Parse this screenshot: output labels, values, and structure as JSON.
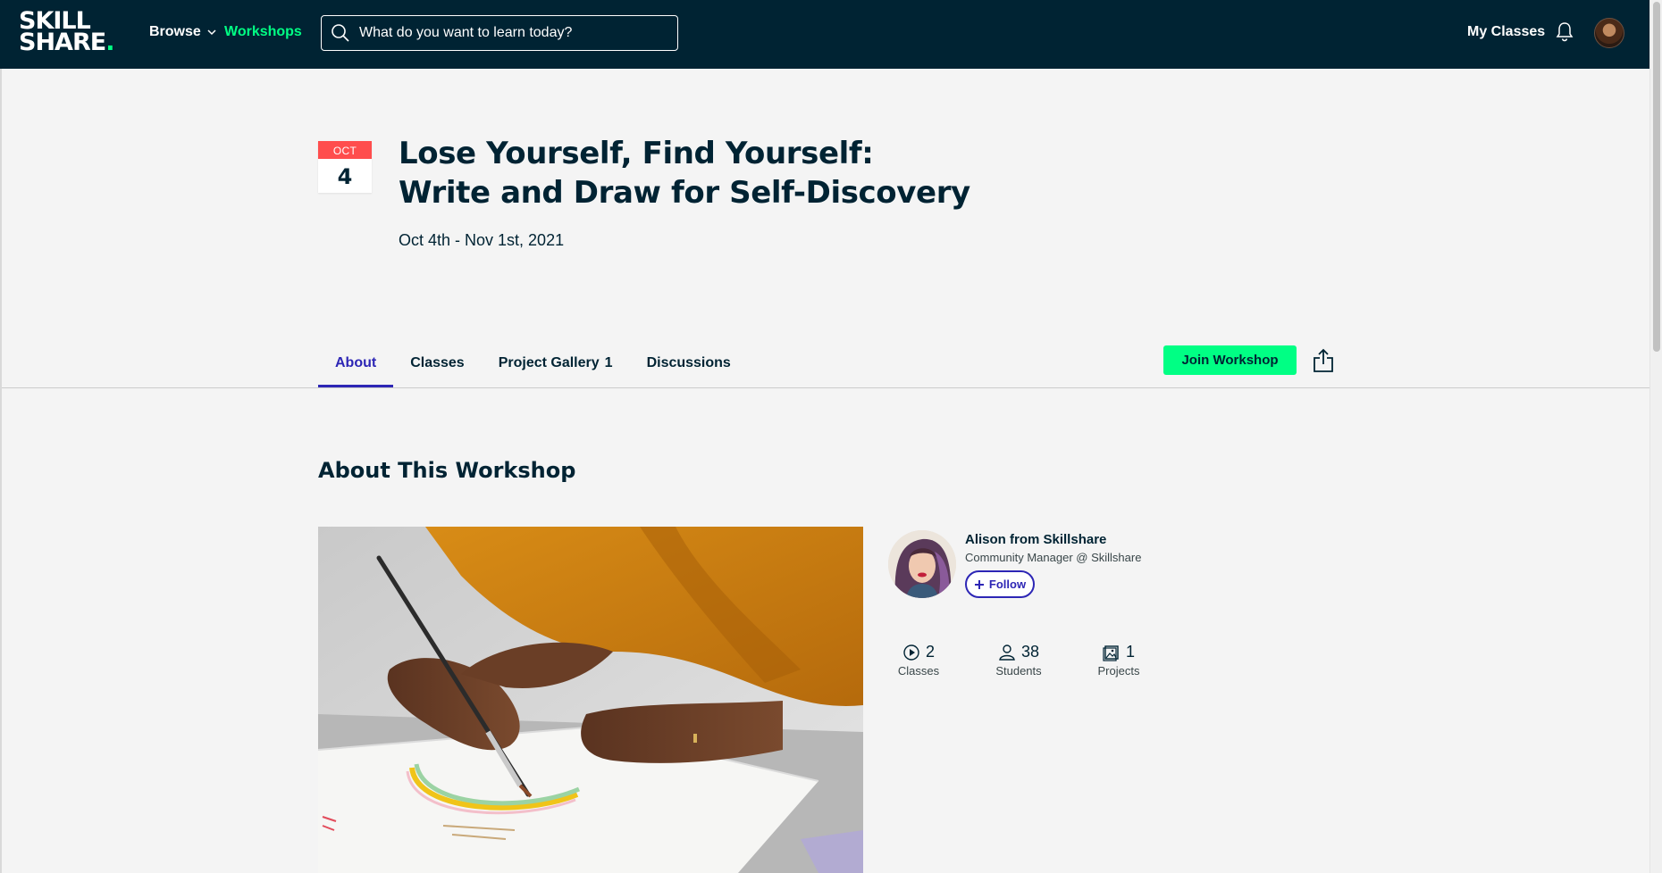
{
  "header": {
    "logo_line1": "SKILL",
    "logo_line2": "SHARE",
    "logo_dot": ".",
    "browse_label": "Browse",
    "workshops_label": "Workshops",
    "search_placeholder": "What do you want to learn today?",
    "my_classes_label": "My Classes"
  },
  "workshop": {
    "date_badge": {
      "month": "OCT",
      "day": "4"
    },
    "title": "Lose Yourself, Find Yourself: Write and Draw for Self-Discovery",
    "date_range": "Oct 4th - Nov 1st, 2021"
  },
  "tabs": [
    {
      "label": "About",
      "active": true
    },
    {
      "label": "Classes"
    },
    {
      "label": "Project Gallery",
      "count": "1"
    },
    {
      "label": "Discussions"
    }
  ],
  "actions": {
    "join_label": "Join Workshop"
  },
  "about": {
    "heading": "About This Workshop"
  },
  "instructor": {
    "name": "Alison from Skillshare",
    "role": "Community Manager @ Skillshare",
    "follow_label": "Follow"
  },
  "stats": [
    {
      "icon": "play-circle-icon",
      "value": "2",
      "label": "Classes"
    },
    {
      "icon": "user-icon",
      "value": "38",
      "label": "Students"
    },
    {
      "icon": "image-gallery-icon",
      "value": "1",
      "label": "Projects"
    }
  ],
  "colors": {
    "header_bg": "#002333",
    "accent_green": "#00ff84",
    "accent_purple": "#2d26b5",
    "badge_red": "#ff4d4d"
  }
}
